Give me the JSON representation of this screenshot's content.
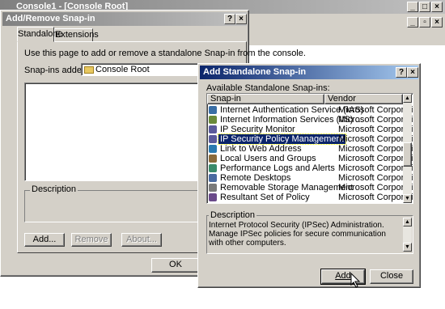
{
  "console": {
    "title": "Console1 - [Console Root]"
  },
  "add_remove": {
    "title": "Add/Remove Snap-in",
    "tabs": [
      "Standalone",
      "Extensions"
    ],
    "instruction": "Use this page to add or remove a standalone Snap-in from the console.",
    "snapins_added_label": "Snap-ins added to:",
    "snapins_added_value": "Console Root",
    "description_label": "Description",
    "add_button": "Add...",
    "remove_button": "Remove",
    "about_button": "About...",
    "ok_button": "OK"
  },
  "add_standalone": {
    "title": "Add Standalone Snap-in",
    "available_label": "Available Standalone Snap-ins:",
    "columns": {
      "snapin": "Snap-in",
      "vendor": "Vendor"
    },
    "rows": [
      {
        "name": "Internet Authentication Service (IAS)",
        "vendor": "Microsoft Corporation",
        "icon": "ias-icon"
      },
      {
        "name": "Internet Information Services (IIS) ...",
        "vendor": "Microsoft Corporation",
        "icon": "iis-icon"
      },
      {
        "name": "IP Security Monitor",
        "vendor": "Microsoft Corporation",
        "icon": "ipsec-monitor-icon"
      },
      {
        "name": "IP Security Policy Management",
        "vendor": "Microsoft Corporation",
        "icon": "ipsec-policy-icon",
        "selected": true
      },
      {
        "name": "Link to Web Address",
        "vendor": "Microsoft Corporation",
        "icon": "web-link-icon"
      },
      {
        "name": "Local Users and Groups",
        "vendor": "Microsoft Corporation",
        "icon": "users-groups-icon"
      },
      {
        "name": "Performance Logs and Alerts",
        "vendor": "Microsoft Corporation",
        "icon": "performance-icon"
      },
      {
        "name": "Remote Desktops",
        "vendor": "Microsoft Corporation",
        "icon": "remote-desktop-icon"
      },
      {
        "name": "Removable Storage Management",
        "vendor": "Microsoft Corporation",
        "icon": "storage-icon"
      },
      {
        "name": "Resultant Set of Policy",
        "vendor": "Microsoft Corporation",
        "icon": "rsop-icon"
      }
    ],
    "description_label": "Description",
    "description_text": "Internet Protocol Security (IPSec) Administration. Manage IPSec policies for secure communication with other computers.",
    "add_button": "Add",
    "close_button": "Close"
  },
  "colors": {
    "active_title": "#0a246a",
    "selection": "#0a246a",
    "face": "#d4d0c8"
  }
}
